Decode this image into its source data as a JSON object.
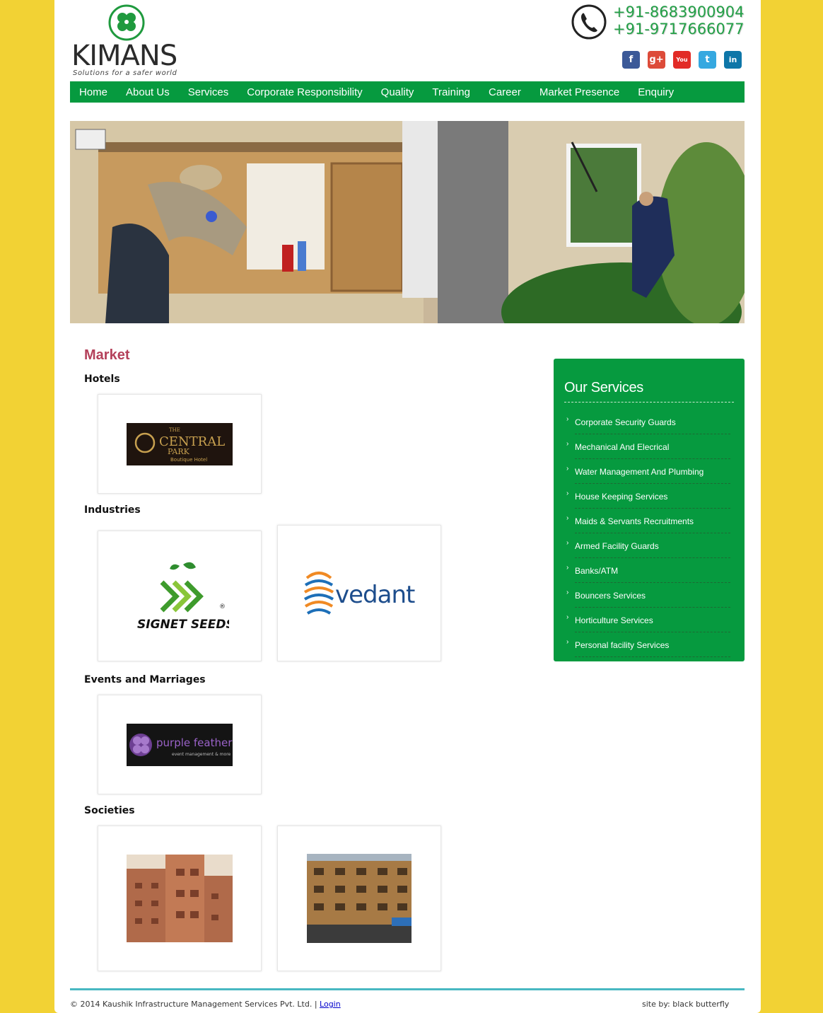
{
  "brand": {
    "name": "KIMANS",
    "tagline": "Solutions for a safer world",
    "green": "#069a3f",
    "page_bg": "#f2d234"
  },
  "contact": {
    "phone_1": "+91-8683900904",
    "phone_2": "+91-9717666077"
  },
  "social": [
    {
      "icon": "facebook-icon",
      "glyph": "f"
    },
    {
      "icon": "google-plus-icon",
      "glyph": "g+"
    },
    {
      "icon": "youtube-icon",
      "glyph": "You"
    },
    {
      "icon": "twitter-icon",
      "glyph": "t"
    },
    {
      "icon": "linkedin-icon",
      "glyph": "in"
    }
  ],
  "nav": [
    "Home",
    "About Us",
    "Services",
    "Corporate Responsibility",
    "Quality",
    "Training",
    "Career",
    "Market Presence",
    "Enquiry"
  ],
  "market": {
    "title": "Market",
    "categories": [
      {
        "name": "Hotels",
        "logos": [
          "THE CENTRAL PARK Boutique Hotel"
        ]
      },
      {
        "name": "Industries",
        "logos": [
          "SIGNET SEEDS",
          "vedanta"
        ]
      },
      {
        "name": "Events and Marriages",
        "logos": [
          "purple feather event management & more"
        ]
      },
      {
        "name": "Societies",
        "logos": []
      }
    ]
  },
  "logo_text": {
    "central_the": "THE",
    "central_name": "CENTRAL",
    "central_park": "PARK",
    "central_sub": "Boutique Hotel",
    "signet": "SIGNET SEEDS",
    "vedanta": "vedanta",
    "purple": "purple feather",
    "purple_sub": "event management & more"
  },
  "sidebar": {
    "title": "Our Services",
    "items": [
      "Corporate Security Guards",
      "Mechanical And Elecrical",
      "Water Management And Plumbing",
      "House Keeping Services",
      "Maids & Servants Recruitments",
      "Armed Facility Guards",
      "Banks/ATM",
      "Bouncers Services",
      "Horticulture Services",
      "Personal facility Services"
    ]
  },
  "footer": {
    "copyright": "© 2014 Kaushik Infrastructure Management Services Pvt. Ltd. |",
    "login": "Login",
    "credit": "site by: black butterfly"
  }
}
